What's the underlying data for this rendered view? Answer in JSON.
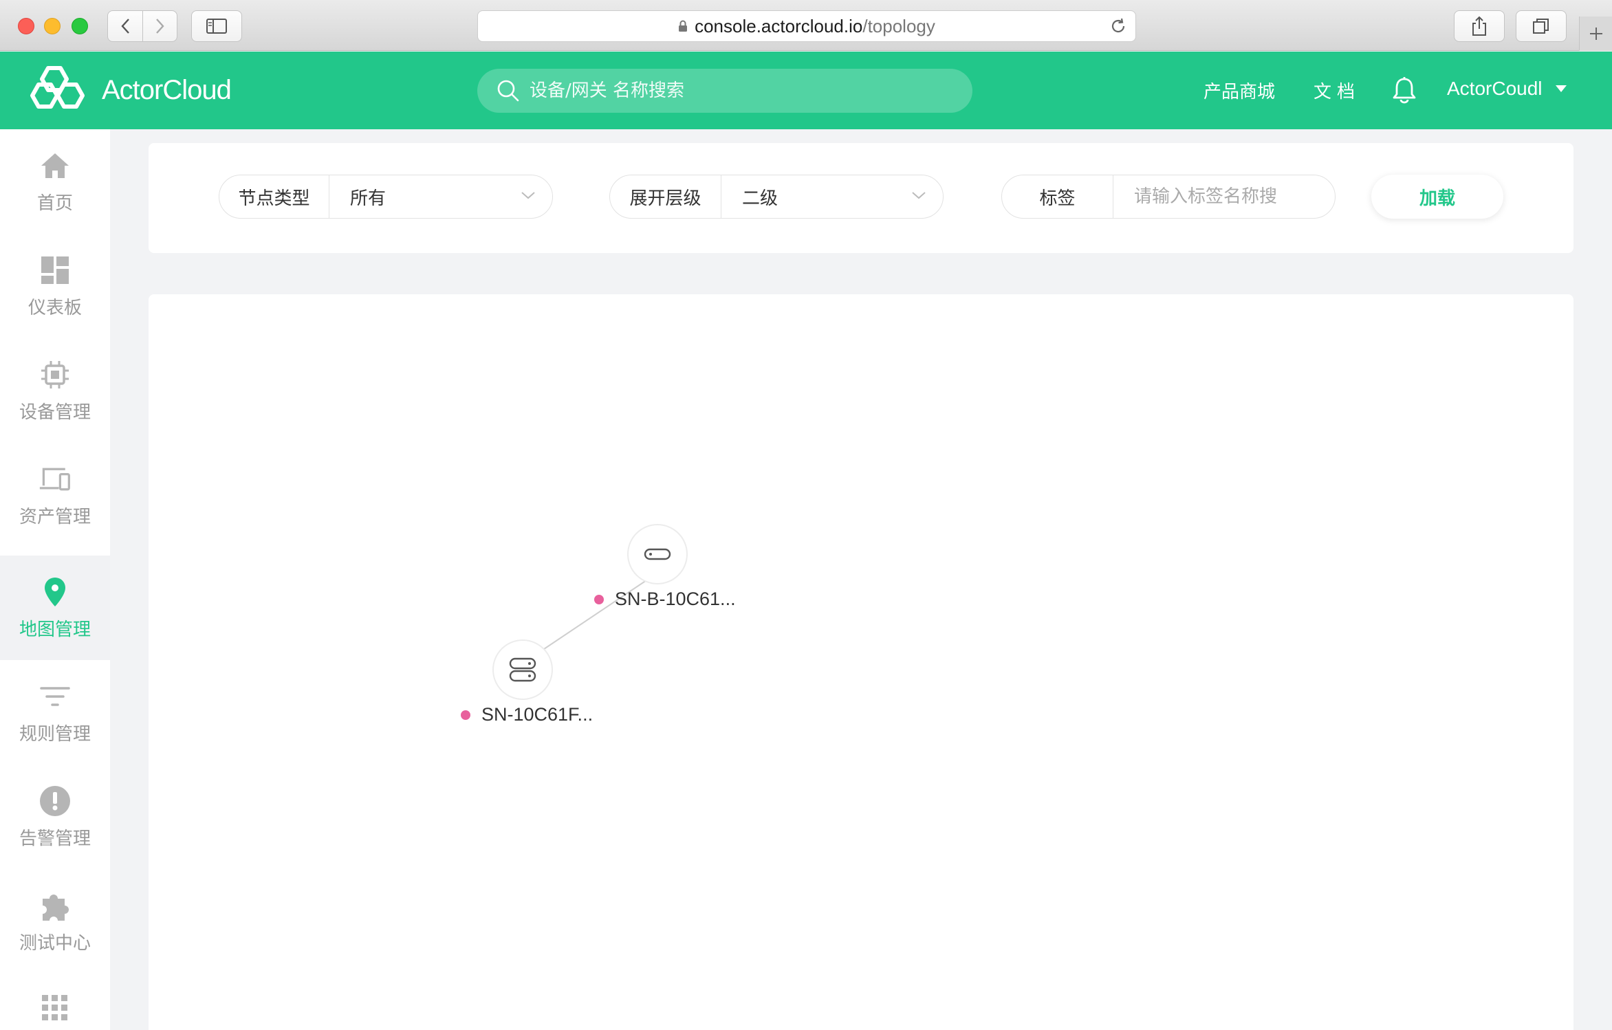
{
  "browser": {
    "url_domain": "console.actorcloud.io",
    "url_path": "/topology"
  },
  "header": {
    "brand": "ActorCloud",
    "search_placeholder": "设备/网关 名称搜索",
    "nav": {
      "store": "产品商城",
      "docs": "文档"
    },
    "user_name": "ActorCoudl"
  },
  "sidebar": {
    "items": [
      {
        "label": "首页",
        "icon": "home-icon"
      },
      {
        "label": "仪表板",
        "icon": "dashboard-icon"
      },
      {
        "label": "设备管理",
        "icon": "chip-icon"
      },
      {
        "label": "资产管理",
        "icon": "devices-icon"
      },
      {
        "label": "地图管理",
        "icon": "map-pin-icon",
        "active": true
      },
      {
        "label": "规则管理",
        "icon": "filter-icon"
      },
      {
        "label": "告警管理",
        "icon": "alert-icon"
      },
      {
        "label": "测试中心",
        "icon": "puzzle-icon"
      },
      {
        "label": "",
        "icon": "apps-grid-icon"
      }
    ]
  },
  "filters": {
    "node_type": {
      "label": "节点类型",
      "value": "所有"
    },
    "expand_level": {
      "label": "展开层级",
      "value": "二级"
    },
    "tag": {
      "label": "标签",
      "placeholder": "请输入标签名称搜"
    },
    "load_button": "加载"
  },
  "topology": {
    "nodes": [
      {
        "label": "SN-B-10C61...",
        "icon": "gateway-icon",
        "status_color": "#e8609c"
      },
      {
        "label": "SN-10C61F...",
        "icon": "server-icon",
        "status_color": "#e8609c"
      }
    ],
    "edges": [
      {
        "from": 0,
        "to": 1
      }
    ]
  },
  "colors": {
    "accent": "#22c78a",
    "status_dot": "#e8609c"
  }
}
